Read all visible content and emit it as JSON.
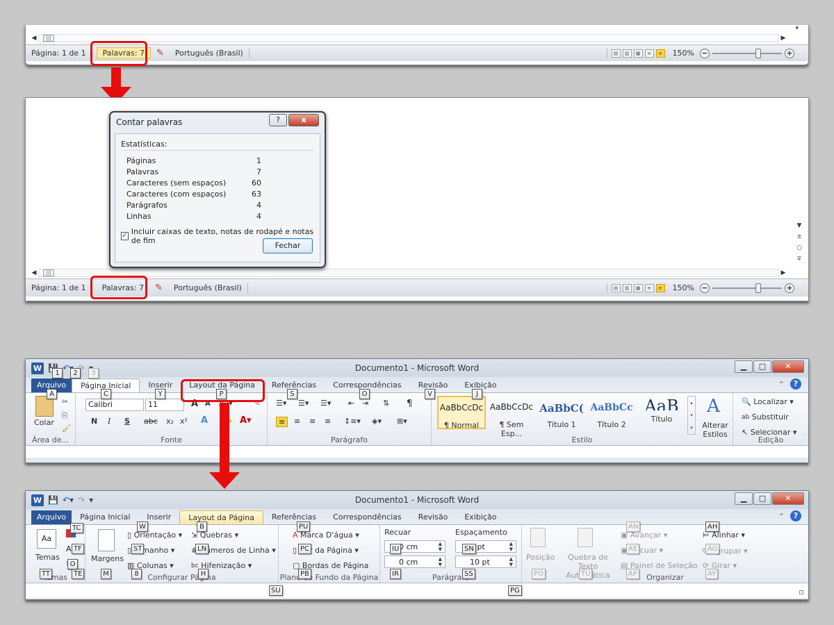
{
  "status": {
    "page": "Página: 1 de 1",
    "words": "Palavras: 7",
    "language": "Português (Brasil)",
    "zoom": "150%"
  },
  "dialog": {
    "title": "Contar palavras",
    "help_btn": "?",
    "close_x": "x",
    "section": "Estatísticas:",
    "rows": [
      {
        "label": "Páginas",
        "value": "1"
      },
      {
        "label": "Palavras",
        "value": "7"
      },
      {
        "label": "Caracteres (sem espaços)",
        "value": "60"
      },
      {
        "label": "Caracteres (com espaços)",
        "value": "63"
      },
      {
        "label": "Parágrafos",
        "value": "4"
      },
      {
        "label": "Linhas",
        "value": "4"
      }
    ],
    "checkbox_label": "Incluir caixas de texto, notas de rodapé e notas de fim",
    "checkbox_checked": true,
    "close_label": "Fechar"
  },
  "word": {
    "title": "Documento1 - Microsoft Word",
    "logo": "W",
    "tabs": [
      "Arquivo",
      "Página Inicial",
      "Inserir",
      "Layout da Página",
      "Referências",
      "Correspondências",
      "Revisão",
      "Exibição"
    ],
    "home": {
      "clipboard": {
        "paste": "Colar",
        "label": "Área de..."
      },
      "font": {
        "name": "Calibri (Corpo)",
        "size": "11",
        "label": "Fonte",
        "b": "N",
        "i": "I",
        "u": "S",
        "strike": "abc",
        "sub": "x₂",
        "sup": "x²"
      },
      "paragraph": {
        "label": "Parágrafo"
      },
      "styles": {
        "label": "Estilo",
        "items": [
          {
            "preview": "AaBbCcDc",
            "name": "¶ Normal"
          },
          {
            "preview": "AaBbCcDc",
            "name": "¶ Sem Esp..."
          },
          {
            "preview": "AaBbC(",
            "name": "Título 1"
          },
          {
            "preview": "AaBbCc",
            "name": "Título 2"
          },
          {
            "preview": "AaB",
            "name": "Título"
          }
        ],
        "change": "Alterar Estilos"
      },
      "editing": {
        "label": "Edição",
        "find": "Localizar",
        "replace": "Substituir",
        "select": "Selecionar"
      },
      "keytips": {
        "A": "A",
        "C": "C",
        "Y": "Y",
        "P": "P",
        "S": "S",
        "O": "O",
        "V": "V",
        "J": "J",
        "q1": "1",
        "q2": "2",
        "q3": "3"
      }
    },
    "layout": {
      "themes": {
        "label": "Temas",
        "btn": "Temas"
      },
      "setup": {
        "label": "Configurar Página",
        "margins": "Margens",
        "orientation": "Orientação",
        "size": "Tamanho",
        "columns": "Colunas",
        "breaks": "Quebras",
        "line_numbers": "Números de Linha",
        "hyphenation": "Hifenização"
      },
      "background": {
        "label": "Plano de Fundo da Página",
        "watermark": "Marca D'água",
        "page_color": "Cor da Página",
        "borders": "Bordas de Página"
      },
      "paragraph": {
        "label": "Parágrafo",
        "indent": "Recuar",
        "spacing": "Espaçamento",
        "left": "0 cm",
        "right": "0 cm",
        "before": "0 pt",
        "after": "10 pt"
      },
      "arrange": {
        "label": "Organizar",
        "position": "Posição",
        "wrap": "Quebra de Texto Automática",
        "forward": "Avançar",
        "backward": "Recuar",
        "pane": "Painel de Seleção",
        "align": "Alinhar",
        "group": "Agrupar",
        "rotate": "Girar"
      },
      "keytips": [
        "W",
        "TC",
        "TF",
        "TE",
        "TT",
        "M",
        "B",
        "ST",
        "LN",
        "O",
        "H",
        "8",
        "PU",
        "PC",
        "PB",
        "SU",
        "IU",
        "IR",
        "SN",
        "SS",
        "PG",
        "PO",
        "TU",
        "AN",
        "AE",
        "AP",
        "AH",
        "AG",
        "AY"
      ]
    }
  },
  "colors": {
    "highlight": "#e31010",
    "file_tab": "#2b5797",
    "accent": "#f8d545"
  }
}
